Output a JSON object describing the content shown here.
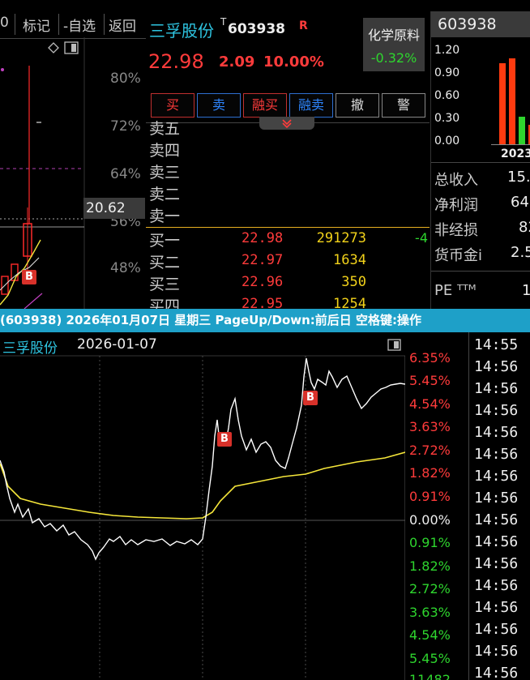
{
  "kline_panel": {
    "toolbar": [
      "0",
      "标记",
      "-自选",
      "返回"
    ],
    "price_label": "20.62",
    "pct_labels": [
      "80%",
      "72%",
      "64%",
      "56%",
      "48%"
    ],
    "b_marker": "B",
    "colors": {
      "up": "#ff2a2a",
      "ma": "#f2e53c",
      "grid": "#b040b0"
    }
  },
  "quote": {
    "name": "三孚股份",
    "t_mark": "T",
    "code": "603938",
    "r_mark": "R",
    "sector_name": "化学原料",
    "sector_change": "-0.32%",
    "price": "22.98",
    "change": "2.09",
    "change_pct": "10.00%",
    "buttons": [
      "买",
      "卖",
      "融买",
      "融卖",
      "撤",
      "警"
    ],
    "sell_levels": [
      "卖五",
      "卖四",
      "卖三",
      "卖二",
      "卖一"
    ],
    "buy_levels": [
      {
        "label": "买一",
        "price": "22.98",
        "volume": "291273",
        "extra": "-4"
      },
      {
        "label": "买二",
        "price": "22.97",
        "volume": "1634",
        "extra": ""
      },
      {
        "label": "买三",
        "price": "22.96",
        "volume": "350",
        "extra": ""
      },
      {
        "label": "买四",
        "price": "22.95",
        "volume": "1254",
        "extra": ""
      }
    ]
  },
  "finance": {
    "code": "603938",
    "y_ticks": [
      "1.20",
      "0.90",
      "0.60",
      "0.30",
      "0.00"
    ],
    "year": "2023",
    "items": [
      {
        "label": "总收入",
        "value": "15."
      },
      {
        "label": "净利润",
        "value": "64"
      },
      {
        "label": "非经损",
        "value": "82"
      },
      {
        "label": "货币金i",
        "value": "2.5"
      },
      {
        "label": "PE ᵀᵀᴹ",
        "value": "1"
      }
    ]
  },
  "status_bar": {
    "text": "(603938) 2026年01月07日 星期三 PageUp/Down:前后日 空格键:操作"
  },
  "intraday": {
    "name": "三孚股份",
    "date": "2026-01-07",
    "right_pct_up": [
      "6.35%",
      "5.45%",
      "4.54%",
      "3.63%",
      "2.72%",
      "1.82%",
      "0.91%",
      "0.00%"
    ],
    "right_pct_down": [
      "0.91%",
      "1.82%",
      "2.72%",
      "3.63%",
      "4.54%",
      "5.45%",
      "11482"
    ],
    "b_markers": [
      "B",
      "B"
    ],
    "colors": {
      "price_line": "#ffffff",
      "avg_line": "#f5e63a",
      "up": "#ff3b3b",
      "down": "#2ed52e"
    }
  },
  "times": [
    "14:55",
    "14:56",
    "14:56",
    "14:56",
    "14:56",
    "14:56",
    "14:56",
    "14:56",
    "14:56",
    "14:56",
    "14:56",
    "14:56",
    "14:56",
    "14:56",
    "14:56",
    "14:56"
  ]
}
